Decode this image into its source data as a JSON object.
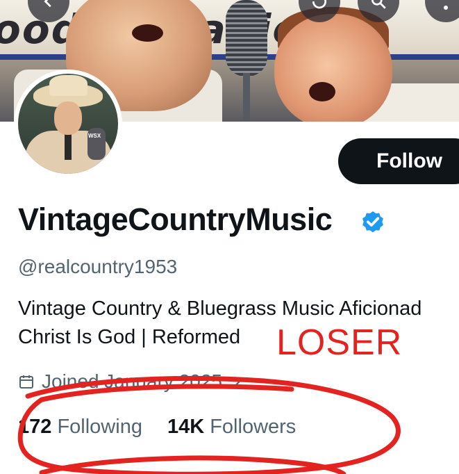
{
  "banner": {
    "sign_text": "oodies  Radio",
    "mic_label": "WSX"
  },
  "profile": {
    "display_name": "VintageCountryMusic",
    "verified": true,
    "handle": "@realcountry1953",
    "bio_line1": "Vintage Country & Bluegrass Music Aficionad",
    "bio_line2": "Christ Is God | Reformed",
    "joined": "Joined January 2025",
    "following_count": "172",
    "following_label": "Following",
    "followers_count": "14K",
    "followers_label": "Followers"
  },
  "actions": {
    "follow_label": "Follow"
  },
  "annotation": {
    "text": "LOSER",
    "color": "#e3231f"
  },
  "colors": {
    "text_primary": "#0f1419",
    "text_secondary": "#536471",
    "verified_blue": "#1d9bf0",
    "follow_bg": "#0f1419"
  },
  "icons": {
    "back": "chevron-left-icon",
    "history": "history-icon",
    "search": "search-icon",
    "more": "more-icon",
    "verified": "verified-badge-icon",
    "calendar": "calendar-icon"
  }
}
